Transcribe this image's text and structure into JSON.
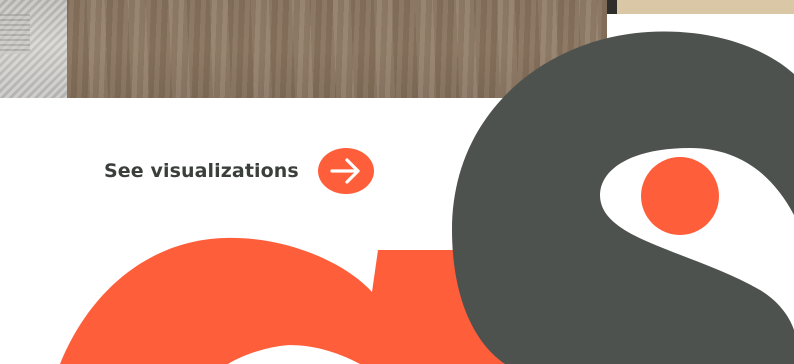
{
  "link": {
    "label": "See visualizations",
    "icon": "arrow-right-icon"
  },
  "colors": {
    "accent": "#FF5E3A",
    "dark": "#4D524E",
    "text": "#3A3F3B",
    "background": "#FFFFFF"
  }
}
